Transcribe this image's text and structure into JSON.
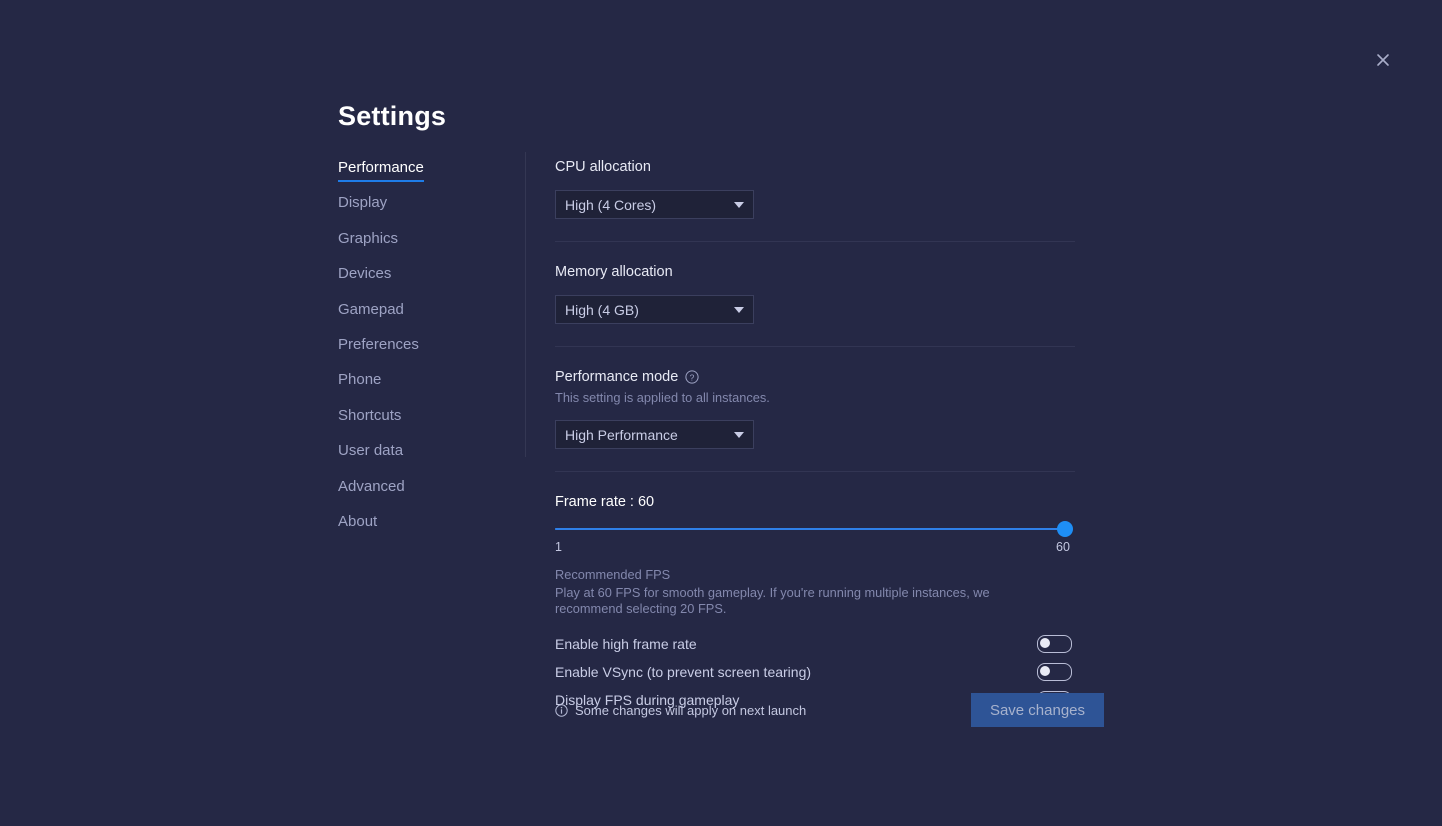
{
  "window": {
    "title": "Settings",
    "close_icon": "close-icon"
  },
  "sidebar": {
    "items": [
      {
        "label": "Performance",
        "active": true
      },
      {
        "label": "Display",
        "active": false
      },
      {
        "label": "Graphics",
        "active": false
      },
      {
        "label": "Devices",
        "active": false
      },
      {
        "label": "Gamepad",
        "active": false
      },
      {
        "label": "Preferences",
        "active": false
      },
      {
        "label": "Phone",
        "active": false
      },
      {
        "label": "Shortcuts",
        "active": false
      },
      {
        "label": "User data",
        "active": false
      },
      {
        "label": "Advanced",
        "active": false
      },
      {
        "label": "About",
        "active": false
      }
    ]
  },
  "main": {
    "cpu": {
      "label": "CPU allocation",
      "value": "High (4 Cores)",
      "caret_icon": "chevron-down-icon"
    },
    "memory": {
      "label": "Memory allocation",
      "value": "High (4 GB)",
      "caret_icon": "chevron-down-icon"
    },
    "performance_mode": {
      "label": "Performance mode",
      "help_icon": "help-circle-icon",
      "sublabel": "This setting is applied to all instances.",
      "value": "High Performance",
      "caret_icon": "chevron-down-icon"
    },
    "frame_rate": {
      "title": "Frame rate : 60",
      "value": 60,
      "min_label": "1",
      "max_label": "60",
      "min": 1,
      "max": 60,
      "recommended_title": "Recommended FPS",
      "recommended_body": "Play at 60 FPS for smooth gameplay. If you're running multiple instances, we recommend selecting 20 FPS."
    },
    "toggles": [
      {
        "label": "Enable high frame rate",
        "on": false
      },
      {
        "label": "Enable VSync (to prevent screen tearing)",
        "on": false
      },
      {
        "label": "Display FPS during gameplay",
        "on": false
      }
    ]
  },
  "footer": {
    "info_icon": "info-circle-icon",
    "note": "Some changes will apply on next launch",
    "save_label": "Save changes"
  },
  "colors": {
    "background": "#252845",
    "accent": "#2f80e8",
    "slider_thumb": "#1e8ef5",
    "save_button": "#2e5496",
    "field_background": "#1f2238"
  }
}
